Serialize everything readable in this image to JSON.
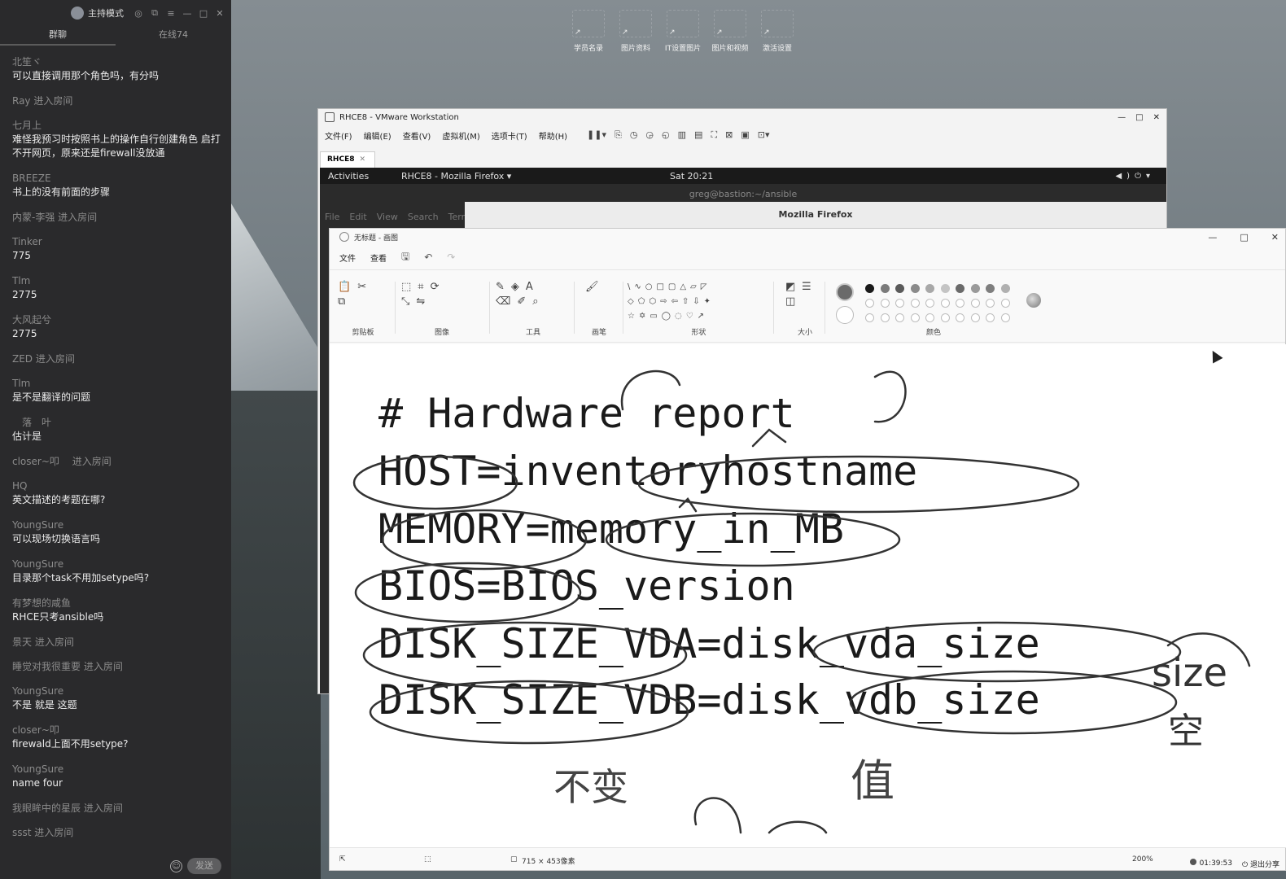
{
  "chat": {
    "mode_label": "主持模式",
    "tabs": [
      "群聊",
      "在线74"
    ],
    "messages": [
      {
        "user": "北笙ヾ",
        "text": "可以直接调用那个角色吗，有分吗"
      },
      {
        "system": "Ray 进入房间"
      },
      {
        "user": "七月上",
        "text": "难怪我预习时按照书上的操作自行创建角色 启打不开网页，原来还是firewall没放通"
      },
      {
        "user": "BREEZE",
        "text": "书上的没有前面的步骤"
      },
      {
        "system": "内蒙-李强 进入房间"
      },
      {
        "user": "Tinker",
        "text": "775"
      },
      {
        "user": "Tlm",
        "text": "2775"
      },
      {
        "user": "大风起兮",
        "text": "2775"
      },
      {
        "system": "ZED 进入房间"
      },
      {
        "user": "Tlm",
        "text": "是不是翻译的问题"
      },
      {
        "user": "　落　叶",
        "text": "估计是"
      },
      {
        "system": "closer~叩　 进入房间"
      },
      {
        "user": "HQ",
        "text": "英文描述的考题在哪?"
      },
      {
        "user": "YoungSure",
        "text": "可以现场切换语言吗"
      },
      {
        "user": "YoungSure",
        "text": "目录那个task不用加setype吗?"
      },
      {
        "user": "有梦想的咸鱼",
        "text": "RHCE只考ansible吗"
      },
      {
        "system": "景天 进入房间"
      },
      {
        "system": "睡觉对我很重要 进入房间"
      },
      {
        "user": "YoungSure",
        "text": "不是 就是 这题"
      },
      {
        "user": "closer~叩",
        "text": "firewald上面不用setype?"
      },
      {
        "user": "YoungSure",
        "text": "name four"
      },
      {
        "system": "我眼眸中的星辰 进入房间"
      },
      {
        "system": "ssst 进入房间"
      }
    ],
    "send_label": "发送"
  },
  "desktop": {
    "icons": [
      "学员名录",
      "图片资料",
      "IT设置图片",
      "图片和视频",
      "激活设置"
    ]
  },
  "vmware": {
    "title": "RHCE8 - VMware Workstation",
    "menu": [
      "文件(F)",
      "编辑(E)",
      "查看(V)",
      "虚拟机(M)",
      "选项卡(T)",
      "帮助(H)"
    ],
    "tab": "RHCE8",
    "guest": {
      "activities": "Activities",
      "app_menu": "RHCE8 - Mozilla Firefox ▾",
      "clock": "Sat 20:21",
      "terminal_title": "greg@bastion:~/ansible",
      "terminal_menu": [
        "File",
        "Edit",
        "View",
        "Search",
        "Terr"
      ],
      "firefox_title": "Mozilla Firefox"
    }
  },
  "paint": {
    "title": "无标题 - 画图",
    "menu": [
      "文件",
      "查看"
    ],
    "groups": [
      "剪贴板",
      "图像",
      "工具",
      "画笔",
      "形状",
      "大小",
      "颜色"
    ],
    "report_lines": [
      "# Hardware report",
      "HOST=inventoryhostname",
      "MEMORY=memory_in_MB",
      "BIOS=BIOS_version",
      "DISK_SIZE_VDA=disk_vda_size",
      "DISK_SIZE_VDB=disk_vdb_size"
    ],
    "handwriting": [
      "size",
      "空",
      "不变",
      "值"
    ],
    "status": {
      "dimensions": "715 × 453像素",
      "zoom": "200%"
    },
    "colors": [
      "#1a1a1a",
      "#7a7a7a",
      "#5a5a5a",
      "#8a8a8a",
      "#a8a8a8",
      "#c4c4c4",
      "#6a6a6a",
      "#9a9a9a",
      "#7e7e7e",
      "#b0b0b0"
    ]
  },
  "recording": {
    "time": "01:39:53",
    "exit_label": "退出分享"
  }
}
